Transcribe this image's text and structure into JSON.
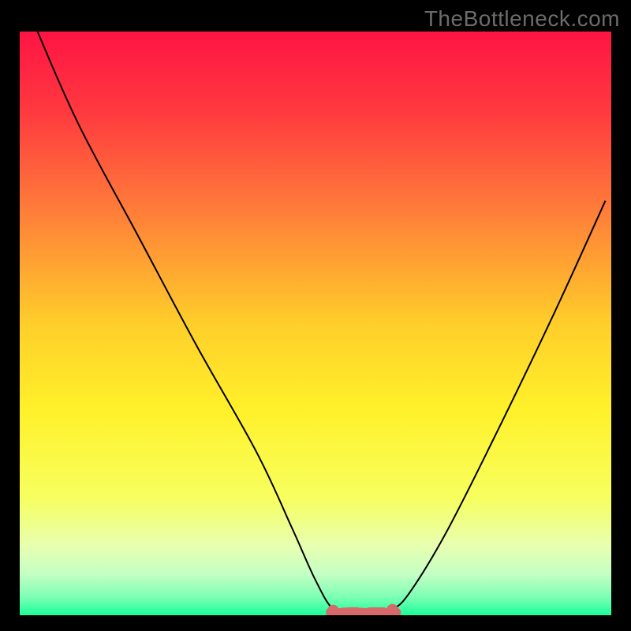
{
  "watermark": "TheBottleneck.com",
  "gradient": {
    "stops": [
      {
        "offset": "0%",
        "color": "#ff1444"
      },
      {
        "offset": "14%",
        "color": "#ff3a3f"
      },
      {
        "offset": "30%",
        "color": "#ff7a3a"
      },
      {
        "offset": "50%",
        "color": "#ffce2a"
      },
      {
        "offset": "65%",
        "color": "#fff12a"
      },
      {
        "offset": "80%",
        "color": "#f7ff60"
      },
      {
        "offset": "88%",
        "color": "#e8ffb0"
      },
      {
        "offset": "93%",
        "color": "#c4ffc4"
      },
      {
        "offset": "97%",
        "color": "#7affb4"
      },
      {
        "offset": "100%",
        "color": "#1aff9a"
      }
    ]
  },
  "chart_data": {
    "type": "line",
    "title": "",
    "xlabel": "",
    "ylabel": "",
    "xlim": [
      0,
      100
    ],
    "ylim": [
      0,
      100
    ],
    "series": [
      {
        "name": "curve",
        "x": [
          3,
          10,
          20,
          30,
          40,
          46,
          50,
          53,
          56,
          60,
          63,
          66,
          72,
          80,
          90,
          99
        ],
        "y": [
          100,
          84,
          65,
          46,
          28,
          15,
          6,
          1,
          0.3,
          0.3,
          1,
          4,
          14,
          30,
          51,
          71
        ]
      }
    ],
    "flat_marker": {
      "color": "#d66a6a",
      "x_start": 53,
      "x_end": 63,
      "y": 0.5,
      "dot_radius": 1.0,
      "thickness": 1.6
    }
  }
}
